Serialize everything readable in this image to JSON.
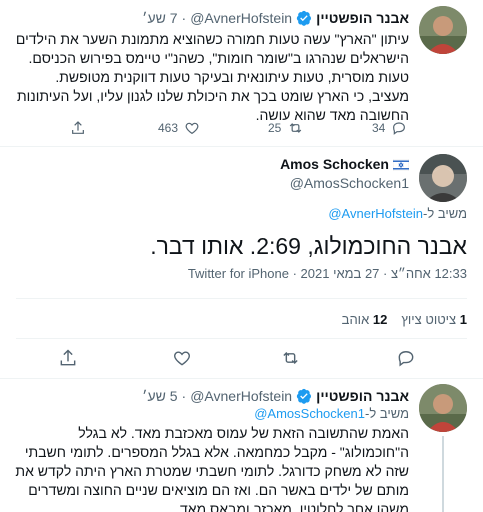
{
  "tweet1": {
    "name": "אבנר הופשטיין",
    "handle": "@AvnerHofstein",
    "dot": "·",
    "time": "7 שע׳",
    "text": "עיתון \"הארץ\" עשה טעות חמורה כשהוציא מתמונת השער את הילדים הישראלים שנהרגו ב\"שומר חומות\", כשהנ\"י טיימס בפירוש הכניסם. טעות מוסרית, טעות עיתונאית ובעיקר טעות דווקנית מטופשת. מעציב, כי הארץ שומט בכך את היכולת שלנו לגנון עליו, ועל העיתונות החשובה מאד שהוא עושה.",
    "replies": "34",
    "retweets": "25",
    "likes": "463"
  },
  "tweet2": {
    "name": "Amos Schocken",
    "handle": "@AmosSchocken1",
    "reply_prefix": "משיב ל-",
    "reply_handle": "@AvnerHofstein",
    "text": "אבנר החוכמולוג, 2:69. אותו דבר.",
    "timestamp": "12:33 אחה״צ · 27 במאי 2021 · ",
    "source": "Twitter for iPhone",
    "quote_count": "1",
    "quote_label": "ציטוט ציוץ",
    "like_count": "12",
    "like_label": "אוהב"
  },
  "tweet3": {
    "name": "אבנר הופשטיין",
    "handle": "@AvnerHofstein",
    "dot": "·",
    "time": "5 שע׳",
    "reply_prefix": "משיב ל-",
    "reply_handle": "@AmosSchocken1",
    "text": "האמת שהתשובה הזאת של עמוס מאכזבת מאד. לא בגלל ה\"חוכמולוג\" - מקבל כמחמאה. אלא בגלל המספרים. לתומי חשבתי שזה לא משחק כדורגל. לתומי חשבתי שמטרת הארץ היתה לקדש את מותם של ילדים באשר הם. ואז הם מוציאים שניים החוצה ומשדרים משהו אחר לחלוטין. מאכזב ומבאס מאד."
  }
}
